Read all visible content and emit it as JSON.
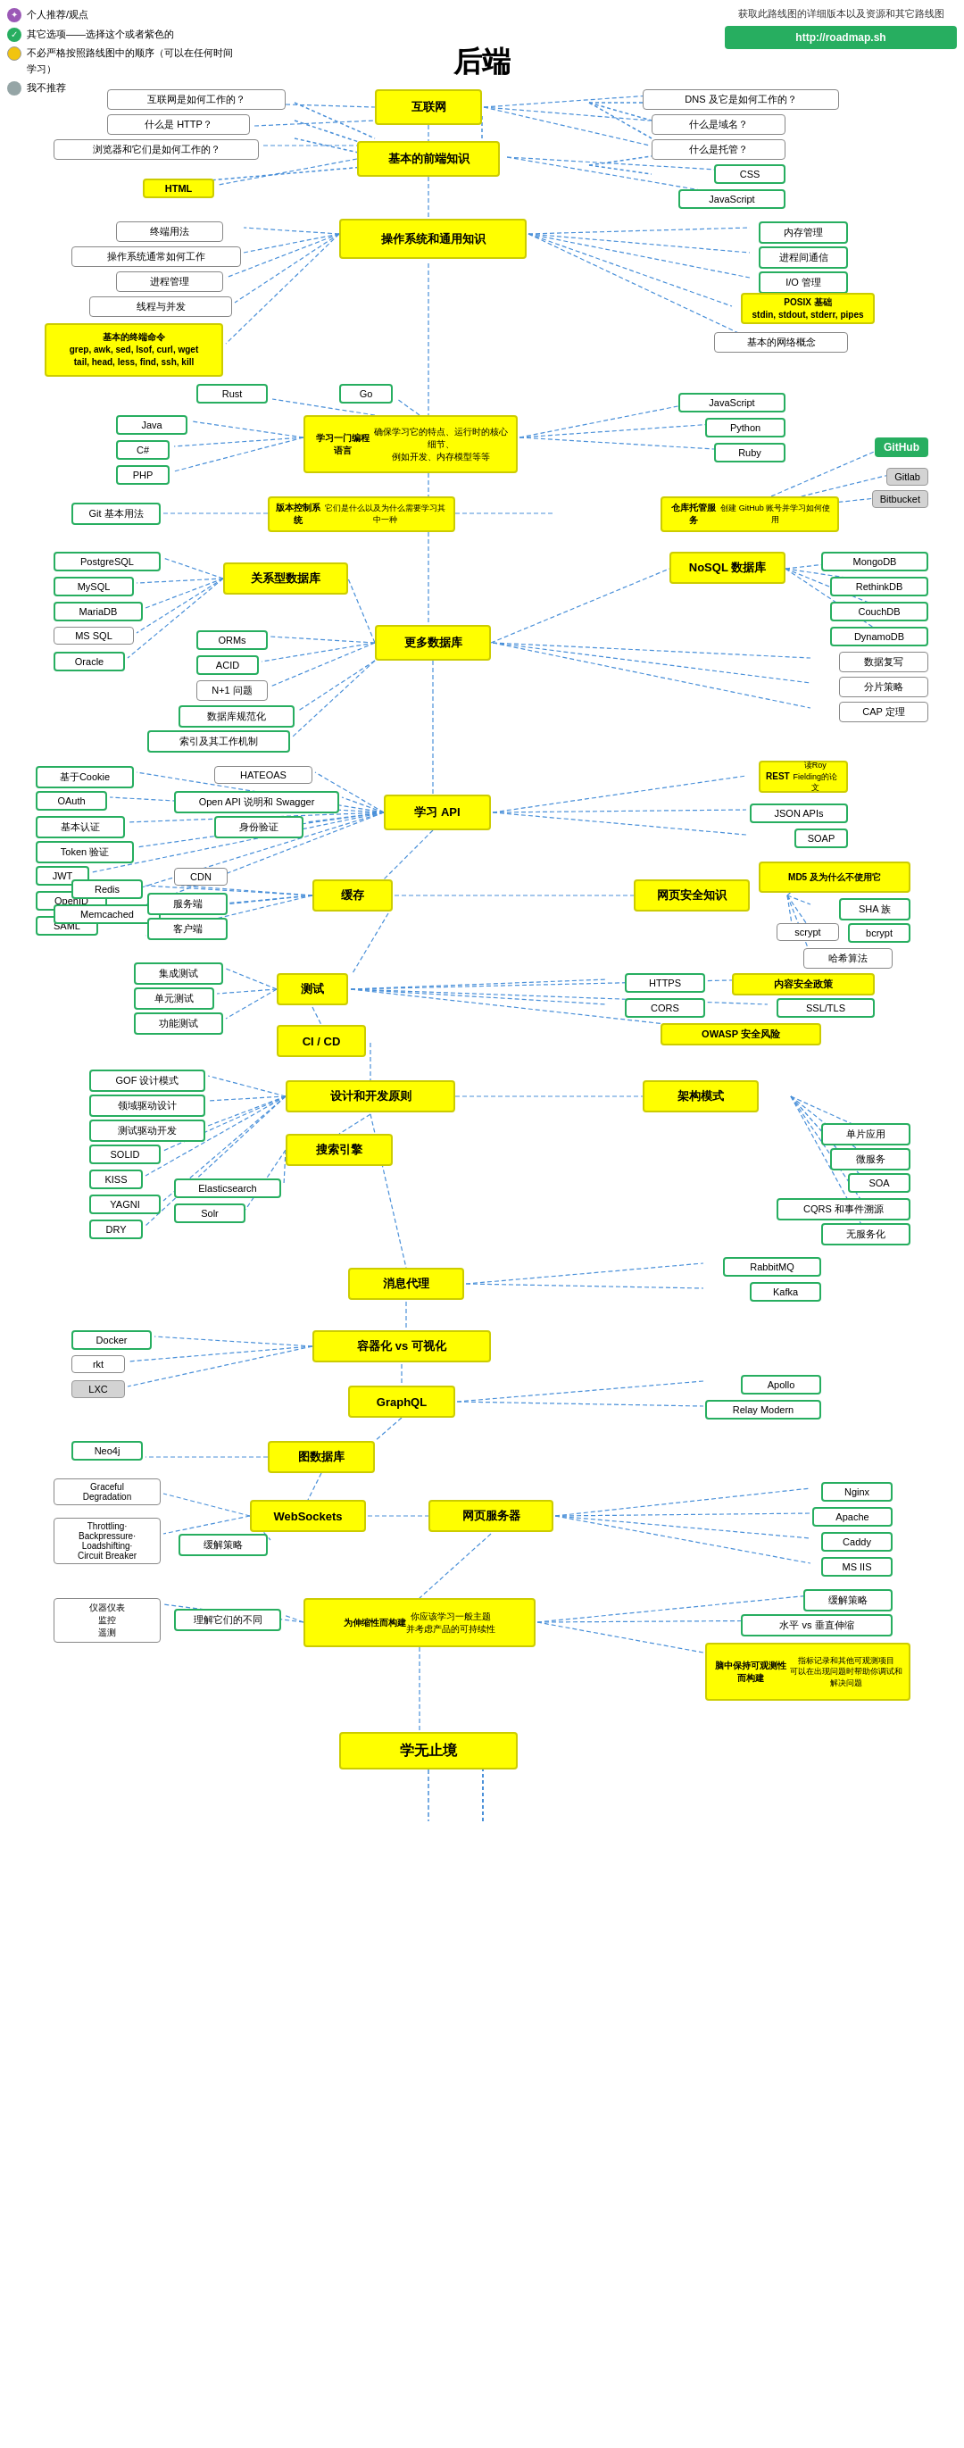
{
  "legend": {
    "items": [
      {
        "icon": "purple",
        "text": "个人推荐/观点"
      },
      {
        "icon": "green",
        "text": "其它选项——选择这个或者紫色的"
      },
      {
        "icon": "yellow",
        "text": "不必严格按照路线图中的顺序（可以在任何时间学习）"
      },
      {
        "icon": "gray",
        "text": "我不推荐"
      }
    ]
  },
  "infobox": {
    "title": "获取此路线图的详细版本以及资源和其它路线图",
    "url": "http://roadmap.sh"
  },
  "title": "后端",
  "nodes": {
    "internet": "互联网",
    "basic_frontend": "基本的前端知识",
    "os_general": "操作系统和通用知识",
    "learn_lang": "学习一门编程语言",
    "vcs": "版本控制系统\n它们是什么以及为什么需要学习其中一种",
    "repo_hosting": "仓库托管服务\n创建 GitHub 账号并学习如何使用",
    "more_db": "更多数据库",
    "relational_db": "关系型数据库",
    "nosql_db": "NoSQL 数据库",
    "learn_api": "学习 API",
    "caching": "缓存",
    "web_security": "网页安全知识",
    "testing": "测试",
    "cicd": "CI / CD",
    "design_dev": "设计和开发原则",
    "search_engine": "搜索引擎",
    "arch_patterns": "架构模式",
    "msg_broker": "消息代理",
    "containerize": "容器化 vs 可视化",
    "graphql": "GraphQL",
    "graph_db": "图数据库",
    "websockets": "WebSockets",
    "web_server": "网页服务器",
    "scalable": "为伸缩性而构建\n你应该学习一般主题\n并考虑产品的可持续性",
    "learn_more": "学无止境"
  }
}
